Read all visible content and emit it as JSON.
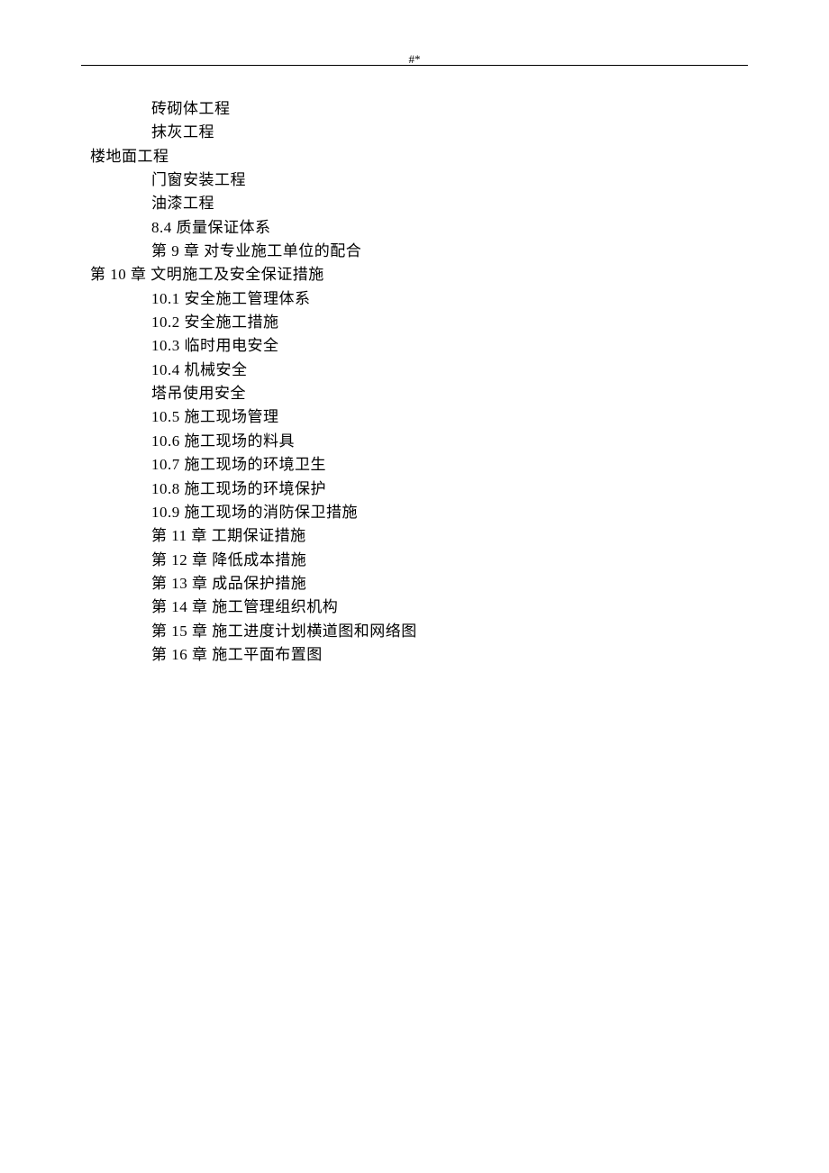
{
  "header": {
    "marker": "#*"
  },
  "lines": [
    {
      "indent": 1,
      "text": "砖砌体工程"
    },
    {
      "indent": 1,
      "text": "抹灰工程"
    },
    {
      "indent": 0,
      "text": "楼地面工程"
    },
    {
      "indent": 1,
      "text": "门窗安装工程"
    },
    {
      "indent": 1,
      "text": "油漆工程"
    },
    {
      "indent": 1,
      "text": "8.4 质量保证体系"
    },
    {
      "indent": 1,
      "text": "第 9 章 对专业施工单位的配合"
    },
    {
      "indent": 0,
      "text": "第 10 章 文明施工及安全保证措施"
    },
    {
      "indent": 1,
      "text": "10.1 安全施工管理体系"
    },
    {
      "indent": 1,
      "text": "10.2 安全施工措施"
    },
    {
      "indent": 1,
      "text": "10.3 临时用电安全"
    },
    {
      "indent": 1,
      "text": "10.4 机械安全"
    },
    {
      "indent": 1,
      "text": "塔吊使用安全"
    },
    {
      "indent": 1,
      "text": "10.5 施工现场管理"
    },
    {
      "indent": 1,
      "text": "10.6 施工现场的料具"
    },
    {
      "indent": 1,
      "text": "10.7 施工现场的环境卫生"
    },
    {
      "indent": 1,
      "text": "10.8 施工现场的环境保护"
    },
    {
      "indent": 1,
      "text": "10.9 施工现场的消防保卫措施"
    },
    {
      "indent": 1,
      "text": "第 11 章 工期保证措施"
    },
    {
      "indent": 1,
      "text": "第 12 章 降低成本措施"
    },
    {
      "indent": 1,
      "text": "第 13 章 成品保护措施"
    },
    {
      "indent": 1,
      "text": "第 14 章 施工管理组织机构"
    },
    {
      "indent": 1,
      "text": "第 15 章 施工进度计划横道图和网络图"
    },
    {
      "indent": 1,
      "text": "第 16 章 施工平面布置图"
    }
  ]
}
